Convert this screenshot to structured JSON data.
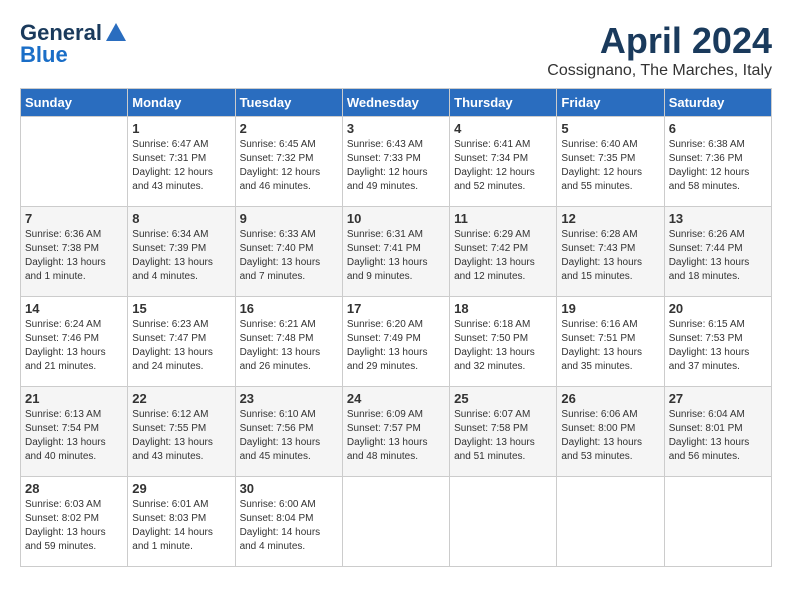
{
  "header": {
    "logo_general": "General",
    "logo_blue": "Blue",
    "month_title": "April 2024",
    "location": "Cossignano, The Marches, Italy"
  },
  "weekdays": [
    "Sunday",
    "Monday",
    "Tuesday",
    "Wednesday",
    "Thursday",
    "Friday",
    "Saturday"
  ],
  "weeks": [
    [
      {
        "day": "",
        "sunrise": "",
        "sunset": "",
        "daylight": ""
      },
      {
        "day": "1",
        "sunrise": "Sunrise: 6:47 AM",
        "sunset": "Sunset: 7:31 PM",
        "daylight": "Daylight: 12 hours and 43 minutes."
      },
      {
        "day": "2",
        "sunrise": "Sunrise: 6:45 AM",
        "sunset": "Sunset: 7:32 PM",
        "daylight": "Daylight: 12 hours and 46 minutes."
      },
      {
        "day": "3",
        "sunrise": "Sunrise: 6:43 AM",
        "sunset": "Sunset: 7:33 PM",
        "daylight": "Daylight: 12 hours and 49 minutes."
      },
      {
        "day": "4",
        "sunrise": "Sunrise: 6:41 AM",
        "sunset": "Sunset: 7:34 PM",
        "daylight": "Daylight: 12 hours and 52 minutes."
      },
      {
        "day": "5",
        "sunrise": "Sunrise: 6:40 AM",
        "sunset": "Sunset: 7:35 PM",
        "daylight": "Daylight: 12 hours and 55 minutes."
      },
      {
        "day": "6",
        "sunrise": "Sunrise: 6:38 AM",
        "sunset": "Sunset: 7:36 PM",
        "daylight": "Daylight: 12 hours and 58 minutes."
      }
    ],
    [
      {
        "day": "7",
        "sunrise": "Sunrise: 6:36 AM",
        "sunset": "Sunset: 7:38 PM",
        "daylight": "Daylight: 13 hours and 1 minute."
      },
      {
        "day": "8",
        "sunrise": "Sunrise: 6:34 AM",
        "sunset": "Sunset: 7:39 PM",
        "daylight": "Daylight: 13 hours and 4 minutes."
      },
      {
        "day": "9",
        "sunrise": "Sunrise: 6:33 AM",
        "sunset": "Sunset: 7:40 PM",
        "daylight": "Daylight: 13 hours and 7 minutes."
      },
      {
        "day": "10",
        "sunrise": "Sunrise: 6:31 AM",
        "sunset": "Sunset: 7:41 PM",
        "daylight": "Daylight: 13 hours and 9 minutes."
      },
      {
        "day": "11",
        "sunrise": "Sunrise: 6:29 AM",
        "sunset": "Sunset: 7:42 PM",
        "daylight": "Daylight: 13 hours and 12 minutes."
      },
      {
        "day": "12",
        "sunrise": "Sunrise: 6:28 AM",
        "sunset": "Sunset: 7:43 PM",
        "daylight": "Daylight: 13 hours and 15 minutes."
      },
      {
        "day": "13",
        "sunrise": "Sunrise: 6:26 AM",
        "sunset": "Sunset: 7:44 PM",
        "daylight": "Daylight: 13 hours and 18 minutes."
      }
    ],
    [
      {
        "day": "14",
        "sunrise": "Sunrise: 6:24 AM",
        "sunset": "Sunset: 7:46 PM",
        "daylight": "Daylight: 13 hours and 21 minutes."
      },
      {
        "day": "15",
        "sunrise": "Sunrise: 6:23 AM",
        "sunset": "Sunset: 7:47 PM",
        "daylight": "Daylight: 13 hours and 24 minutes."
      },
      {
        "day": "16",
        "sunrise": "Sunrise: 6:21 AM",
        "sunset": "Sunset: 7:48 PM",
        "daylight": "Daylight: 13 hours and 26 minutes."
      },
      {
        "day": "17",
        "sunrise": "Sunrise: 6:20 AM",
        "sunset": "Sunset: 7:49 PM",
        "daylight": "Daylight: 13 hours and 29 minutes."
      },
      {
        "day": "18",
        "sunrise": "Sunrise: 6:18 AM",
        "sunset": "Sunset: 7:50 PM",
        "daylight": "Daylight: 13 hours and 32 minutes."
      },
      {
        "day": "19",
        "sunrise": "Sunrise: 6:16 AM",
        "sunset": "Sunset: 7:51 PM",
        "daylight": "Daylight: 13 hours and 35 minutes."
      },
      {
        "day": "20",
        "sunrise": "Sunrise: 6:15 AM",
        "sunset": "Sunset: 7:53 PM",
        "daylight": "Daylight: 13 hours and 37 minutes."
      }
    ],
    [
      {
        "day": "21",
        "sunrise": "Sunrise: 6:13 AM",
        "sunset": "Sunset: 7:54 PM",
        "daylight": "Daylight: 13 hours and 40 minutes."
      },
      {
        "day": "22",
        "sunrise": "Sunrise: 6:12 AM",
        "sunset": "Sunset: 7:55 PM",
        "daylight": "Daylight: 13 hours and 43 minutes."
      },
      {
        "day": "23",
        "sunrise": "Sunrise: 6:10 AM",
        "sunset": "Sunset: 7:56 PM",
        "daylight": "Daylight: 13 hours and 45 minutes."
      },
      {
        "day": "24",
        "sunrise": "Sunrise: 6:09 AM",
        "sunset": "Sunset: 7:57 PM",
        "daylight": "Daylight: 13 hours and 48 minutes."
      },
      {
        "day": "25",
        "sunrise": "Sunrise: 6:07 AM",
        "sunset": "Sunset: 7:58 PM",
        "daylight": "Daylight: 13 hours and 51 minutes."
      },
      {
        "day": "26",
        "sunrise": "Sunrise: 6:06 AM",
        "sunset": "Sunset: 8:00 PM",
        "daylight": "Daylight: 13 hours and 53 minutes."
      },
      {
        "day": "27",
        "sunrise": "Sunrise: 6:04 AM",
        "sunset": "Sunset: 8:01 PM",
        "daylight": "Daylight: 13 hours and 56 minutes."
      }
    ],
    [
      {
        "day": "28",
        "sunrise": "Sunrise: 6:03 AM",
        "sunset": "Sunset: 8:02 PM",
        "daylight": "Daylight: 13 hours and 59 minutes."
      },
      {
        "day": "29",
        "sunrise": "Sunrise: 6:01 AM",
        "sunset": "Sunset: 8:03 PM",
        "daylight": "Daylight: 14 hours and 1 minute."
      },
      {
        "day": "30",
        "sunrise": "Sunrise: 6:00 AM",
        "sunset": "Sunset: 8:04 PM",
        "daylight": "Daylight: 14 hours and 4 minutes."
      },
      {
        "day": "",
        "sunrise": "",
        "sunset": "",
        "daylight": ""
      },
      {
        "day": "",
        "sunrise": "",
        "sunset": "",
        "daylight": ""
      },
      {
        "day": "",
        "sunrise": "",
        "sunset": "",
        "daylight": ""
      },
      {
        "day": "",
        "sunrise": "",
        "sunset": "",
        "daylight": ""
      }
    ]
  ]
}
